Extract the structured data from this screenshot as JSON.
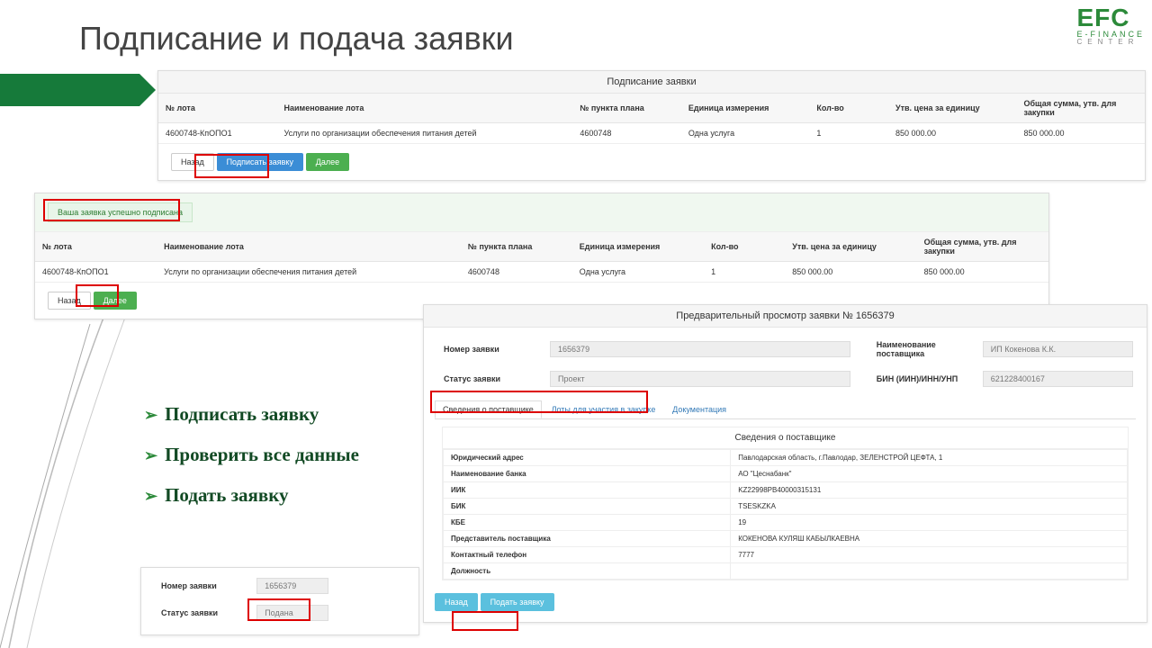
{
  "slide": {
    "title": "Подписание и подача заявки",
    "logo_main": "EFC",
    "logo_sub1": "E-FINANCE",
    "logo_sub2": "CENTER"
  },
  "bullets": [
    "Подписать заявку",
    "Проверить все данные",
    "Подать заявку"
  ],
  "panel1": {
    "header": "Подписание заявки",
    "cols": [
      "№ лота",
      "Наименование лота",
      "№ пункта плана",
      "Единица измерения",
      "Кол-во",
      "Утв. цена за единицу",
      "Общая сумма, утв. для закупки"
    ],
    "row": [
      "4600748-КпОПО1",
      "Услуги по организации обеспечения питания детей",
      "4600748",
      "Одна услуга",
      "1",
      "850 000.00",
      "850 000.00"
    ],
    "btn_back": "Назад",
    "btn_sign": "Подписать заявку",
    "btn_next": "Далее"
  },
  "panel2": {
    "alert": "Ваша заявка успешно подписана",
    "cols": [
      "№ лота",
      "Наименование лота",
      "№ пункта плана",
      "Единица измерения",
      "Кол-во",
      "Утв. цена за единицу",
      "Общая сумма, утв. для закупки"
    ],
    "row": [
      "4600748-КпОПО1",
      "Услуги по организации обеспечения питания детей",
      "4600748",
      "Одна услуга",
      "1",
      "850 000.00",
      "850 000.00"
    ],
    "btn_back": "Назад",
    "btn_next": "Далее"
  },
  "panel3": {
    "label_num": "Номер заявки",
    "value_num": "1656379",
    "label_status": "Статус заявки",
    "value_status": "Подана"
  },
  "preview": {
    "header": "Предварительный просмотр заявки № 1656379",
    "f1_label": "Номер заявки",
    "f1_value": "1656379",
    "f2_label": "Статус заявки",
    "f2_value": "Проект",
    "f3_label": "Наименование поставщика",
    "f3_value": "ИП Кокенова К.К.",
    "f4_label": "БИН (ИИН)/ИНН/УНП",
    "f4_value": "621228400167",
    "tabs": [
      "Сведения о поставщике",
      "Лоты для участия в закупке",
      "Документация"
    ],
    "supplier_header": "Сведения о поставщике",
    "supplier_rows": [
      [
        "Юридический адрес",
        "Павлодарская область, г.Павлодар, ЗЕЛЕНСТРОЙ ЦЕФТА, 1"
      ],
      [
        "Наименование банка",
        "АО \"Цеснабанк\""
      ],
      [
        "ИИК",
        "KZ22998РВ40000315131"
      ],
      [
        "БИК",
        "TSESKZKA"
      ],
      [
        "КБЕ",
        "19"
      ],
      [
        "Представитель поставщика",
        "КОКЕНОВА КУЛЯШ КАБЫЛКАЕВНА"
      ],
      [
        "Контактный телефон",
        "7777"
      ],
      [
        "Должность",
        ""
      ]
    ],
    "btn_back": "Назад",
    "btn_submit": "Подать заявку"
  }
}
